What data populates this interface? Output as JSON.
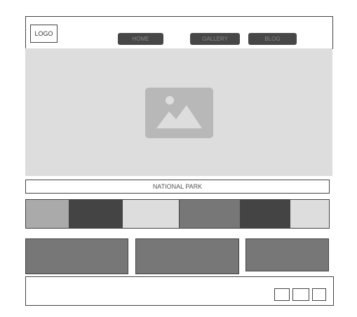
{
  "header": {
    "logo": "LOGO",
    "nav": [
      {
        "label": "HOME"
      },
      {
        "label": "GALLERY"
      },
      {
        "label": "BLOG"
      }
    ]
  },
  "hero": {
    "icon": "image-placeholder-icon"
  },
  "section_title": "NATIONAL PARK",
  "colors": {
    "strip": [
      "#aaaaaa",
      "#444444",
      "#dddddd",
      "#777777",
      "#444444",
      "#dddddd"
    ],
    "card": "#777777",
    "nav": "#474747",
    "hero": "#dddddd"
  }
}
